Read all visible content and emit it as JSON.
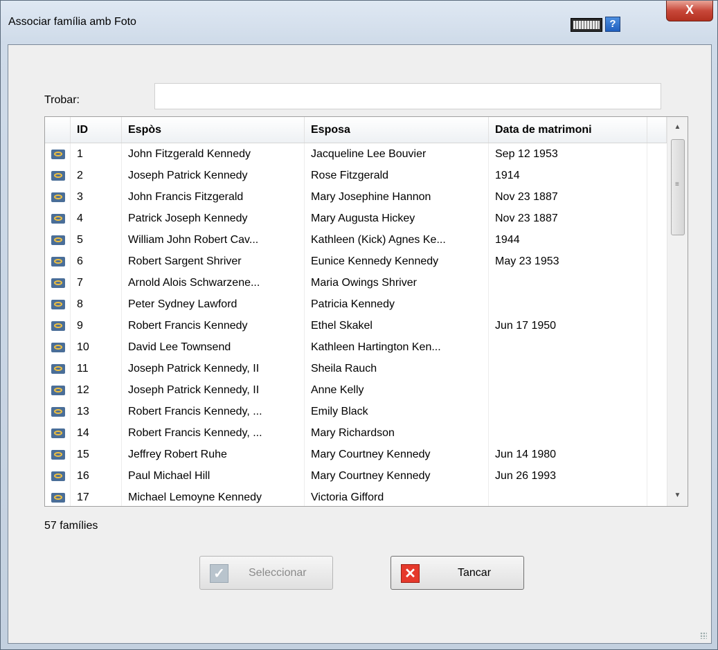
{
  "window": {
    "title": "Associar família amb Foto",
    "keyboard_icon": "keyboard-icon",
    "help_label": "?",
    "close_label": "X"
  },
  "search": {
    "label": "Trobar:",
    "value": "",
    "placeholder": ""
  },
  "table": {
    "columns": [
      "",
      "ID",
      "Espòs",
      "Esposa",
      "Data de matrimoni"
    ],
    "rows": [
      {
        "id": "1",
        "husband": "John Fitzgerald Kennedy",
        "wife": "Jacqueline Lee Bouvier",
        "date": "Sep 12 1953"
      },
      {
        "id": "2",
        "husband": "Joseph Patrick Kennedy",
        "wife": "Rose Fitzgerald",
        "date": "1914"
      },
      {
        "id": "3",
        "husband": "John Francis Fitzgerald",
        "wife": "Mary Josephine Hannon",
        "date": "Nov 23 1887"
      },
      {
        "id": "4",
        "husband": "Patrick Joseph Kennedy",
        "wife": "Mary Augusta Hickey",
        "date": "Nov 23 1887"
      },
      {
        "id": "5",
        "husband": "William John Robert Cav...",
        "wife": "Kathleen (Kick) Agnes Ke...",
        "date": "1944"
      },
      {
        "id": "6",
        "husband": "Robert Sargent Shriver",
        "wife": "Eunice Kennedy Kennedy",
        "date": "May 23 1953"
      },
      {
        "id": "7",
        "husband": "Arnold Alois Schwarzene...",
        "wife": "Maria Owings Shriver",
        "date": ""
      },
      {
        "id": "8",
        "husband": "Peter Sydney Lawford",
        "wife": "Patricia Kennedy",
        "date": ""
      },
      {
        "id": "9",
        "husband": "Robert Francis Kennedy",
        "wife": "Ethel Skakel",
        "date": "Jun 17 1950"
      },
      {
        "id": "10",
        "husband": "David Lee Townsend",
        "wife": "Kathleen Hartington Ken...",
        "date": ""
      },
      {
        "id": "11",
        "husband": "Joseph Patrick Kennedy, II",
        "wife": "Sheila Rauch",
        "date": ""
      },
      {
        "id": "12",
        "husband": "Joseph Patrick Kennedy, II",
        "wife": "Anne Kelly",
        "date": ""
      },
      {
        "id": "13",
        "husband": "Robert Francis Kennedy, ...",
        "wife": "Emily Black",
        "date": ""
      },
      {
        "id": "14",
        "husband": "Robert Francis Kennedy, ...",
        "wife": "Mary Richardson",
        "date": ""
      },
      {
        "id": "15",
        "husband": "Jeffrey Robert Ruhe",
        "wife": "Mary Courtney Kennedy",
        "date": "Jun 14 1980"
      },
      {
        "id": "16",
        "husband": "Paul Michael Hill",
        "wife": "Mary Courtney Kennedy",
        "date": "Jun 26 1993"
      },
      {
        "id": "17",
        "husband": "Michael Lemoyne Kennedy",
        "wife": "Victoria Gifford",
        "date": ""
      }
    ],
    "row_icon": "family-ring-icon"
  },
  "status": {
    "count": "57 famílies"
  },
  "buttons": {
    "select": "Seleccionar",
    "cancel": "Tancar"
  },
  "colors": {
    "accent_close": "#c8483a",
    "cancel_icon": "#e5392c"
  }
}
